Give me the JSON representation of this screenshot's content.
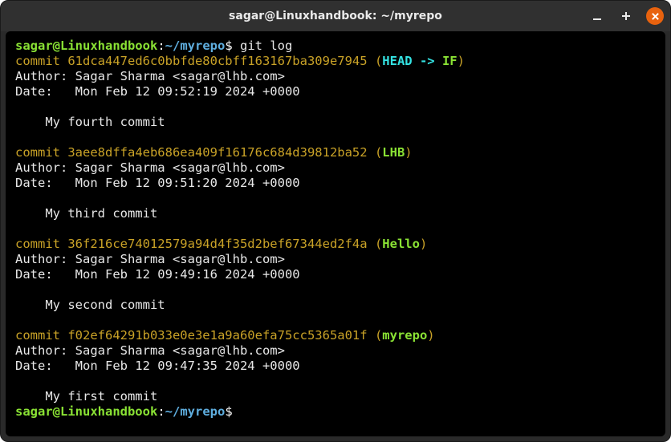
{
  "window": {
    "title": "sagar@Linuxhandbook: ~/myrepo"
  },
  "prompt": {
    "user": "sagar@Linuxhandbook",
    "sep1": ":",
    "path": "~/myrepo",
    "sep2": "$"
  },
  "cmd": " git log",
  "commits": [
    {
      "header_prefix": "commit ",
      "hash": "61dca447ed6c0bbfde80cbff163167ba309e7945",
      "ref_open": " (",
      "head_label": "HEAD -> ",
      "ref_name": "IF",
      "ref_close": ")",
      "author_line": "Author: Sagar Sharma <sagar@lhb.com>",
      "date_line": "Date:   Mon Feb 12 09:52:19 2024 +0000",
      "message": "    My fourth commit"
    },
    {
      "header_prefix": "commit ",
      "hash": "3aee8dffa4eb686ea409f16176c684d39812ba52",
      "ref_open": " (",
      "head_label": "",
      "ref_name": "LHB",
      "ref_close": ")",
      "author_line": "Author: Sagar Sharma <sagar@lhb.com>",
      "date_line": "Date:   Mon Feb 12 09:51:20 2024 +0000",
      "message": "    My third commit"
    },
    {
      "header_prefix": "commit ",
      "hash": "36f216ce74012579a94d4f35d2bef67344ed2f4a",
      "ref_open": " (",
      "head_label": "",
      "ref_name": "Hello",
      "ref_close": ")",
      "author_line": "Author: Sagar Sharma <sagar@lhb.com>",
      "date_line": "Date:   Mon Feb 12 09:49:16 2024 +0000",
      "message": "    My second commit"
    },
    {
      "header_prefix": "commit ",
      "hash": "f02ef64291b033e0e3e1a9a60efa75cc5365a01f",
      "ref_open": " (",
      "head_label": "",
      "ref_name": "myrepo",
      "ref_close": ")",
      "author_line": "Author: Sagar Sharma <sagar@lhb.com>",
      "date_line": "Date:   Mon Feb 12 09:47:35 2024 +0000",
      "message": "    My first commit"
    }
  ]
}
